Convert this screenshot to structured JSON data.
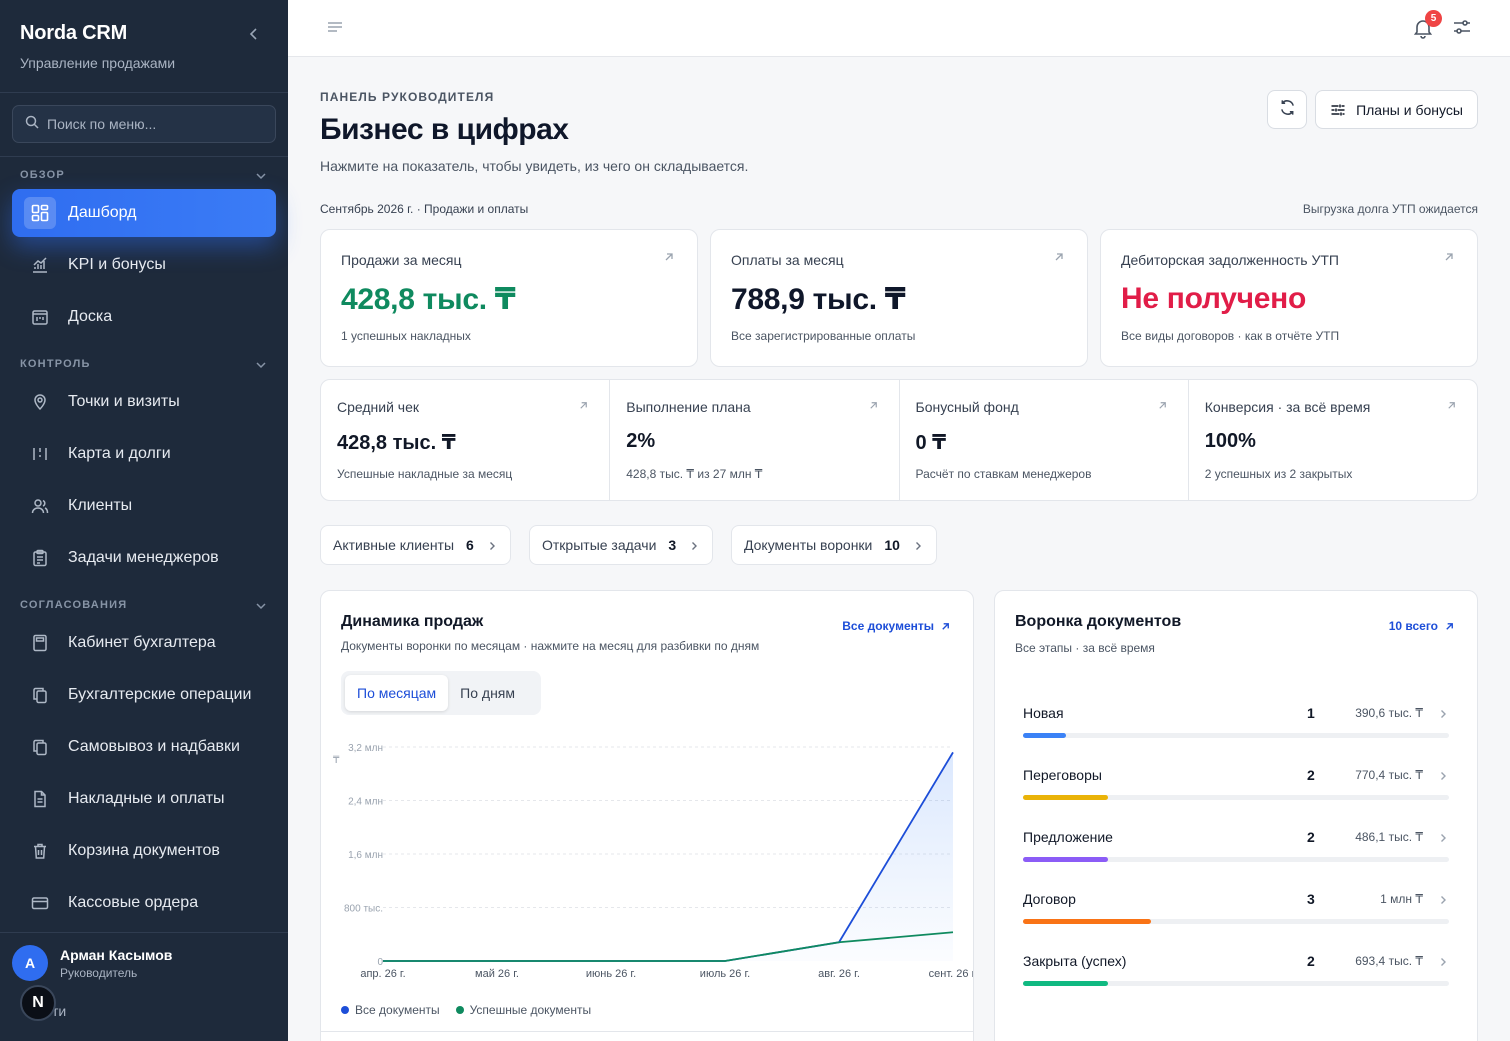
{
  "sidebar": {
    "brand_title": "Norda CRM",
    "brand_subtitle": "Управление продажами",
    "search_placeholder": "Поиск по меню...",
    "sections": {
      "overview": "ОБЗОР",
      "control": "КОНТРОЛЬ",
      "approvals": "СОГЛАСОВАНИЯ"
    },
    "items": [
      {
        "label": "Дашборд",
        "icon": "dashboard-icon",
        "active": true
      },
      {
        "label": "KPI и бонусы",
        "icon": "chart-icon"
      },
      {
        "label": "Доска",
        "icon": "board-icon"
      },
      {
        "label": "Точки и визиты",
        "icon": "map-pin-icon"
      },
      {
        "label": "Карта и долги",
        "icon": "map-icon"
      },
      {
        "label": "Клиенты",
        "icon": "users-icon"
      },
      {
        "label": "Задачи менеджеров",
        "icon": "clipboard-icon"
      },
      {
        "label": "Кабинет бухгалтера",
        "icon": "calculator-icon"
      },
      {
        "label": "Бухгалтерские операции",
        "icon": "copy-icon"
      },
      {
        "label": "Самовывоз и надбавки",
        "icon": "copy-icon"
      },
      {
        "label": "Накладные и оплаты",
        "icon": "file-icon"
      },
      {
        "label": "Корзина документов",
        "icon": "trash-icon"
      },
      {
        "label": "Кассовые ордера",
        "icon": "card-icon"
      }
    ],
    "user": {
      "initial": "А",
      "name": "Арман Касымов",
      "role": "Руководитель"
    },
    "logout_partial": "ти",
    "n_badge": "N"
  },
  "topbar": {
    "notifications_count": "5"
  },
  "header": {
    "eyebrow": "ПАНЕЛЬ РУКОВОДИТЕЛЯ",
    "title": "Бизнес в цифрах",
    "subtitle": "Нажмите на показатель, чтобы увидеть, из чего он складывается.",
    "plans_button": "Планы и бонусы",
    "meta_left": "Сентябрь 2026 г. · Продажи и оплаты",
    "meta_right": "Выгрузка долга УТП ожидается"
  },
  "kpis": [
    {
      "label": "Продажи за месяц",
      "value": "428,8 тыс. ₸",
      "note": "1 успешных накладных",
      "color": "#0f8a5f"
    },
    {
      "label": "Оплаты за месяц",
      "value": "788,9 тыс. ₸",
      "note": "Все зарегистрированные оплаты",
      "color": "#0f172a"
    },
    {
      "label": "Дебиторская задолженность УТП",
      "value": "Не получено",
      "note": "Все виды договоров · как в отчёте УТП",
      "color": "#e11d48"
    }
  ],
  "stats": [
    {
      "label": "Средний чек",
      "value": "428,8 тыс. ₸",
      "note": "Успешные накладные за месяц"
    },
    {
      "label": "Выполнение плана",
      "value": "2%",
      "note": "428,8 тыс. ₸ из 27 млн ₸"
    },
    {
      "label": "Бонусный фонд",
      "value": "0 ₸",
      "note": "Расчёт по ставкам менеджеров"
    },
    {
      "label": "Конверсия · за всё время",
      "value": "100%",
      "note": "2 успешных из 2 закрытых"
    }
  ],
  "chips": [
    {
      "label": "Активные клиенты",
      "count": "6"
    },
    {
      "label": "Открытые задачи",
      "count": "3"
    },
    {
      "label": "Документы воронки",
      "count": "10"
    }
  ],
  "sales_chart": {
    "title": "Динамика продаж",
    "subtitle": "Документы воронки по месяцам · нажмите на месяц для разбивки по дням",
    "link": "Все документы",
    "tabs": [
      "По месяцам",
      "По дням"
    ],
    "legend": [
      "Все документы",
      "Успешные документы"
    ]
  },
  "chart_data": {
    "type": "area",
    "categories": [
      "апр. 26 г.",
      "май 26 г.",
      "июнь 26 г.",
      "июль 26 г.",
      "авг. 26 г.",
      "сент. 26 г."
    ],
    "y_ticks": [
      "0",
      "800 тыс.",
      "1,6 млн",
      "2,4 млн",
      "3,2 млн"
    ],
    "y_unit": "₸",
    "ylim": [
      0,
      3200000
    ],
    "grid": true,
    "series": [
      {
        "name": "Все документы",
        "color": "#1d4ed8",
        "values": [
          0,
          0,
          0,
          0,
          280000,
          3120000
        ]
      },
      {
        "name": "Успешные документы",
        "color": "#0f8a5f",
        "values": [
          0,
          0,
          0,
          0,
          280000,
          430000
        ]
      }
    ]
  },
  "funnel": {
    "title": "Воронка документов",
    "subtitle": "Все этапы · за всё время",
    "link": "10 всего",
    "stages": [
      {
        "name": "Новая",
        "count": "1",
        "sum": "390,6 тыс. ₸",
        "share": 0.1,
        "color": "#3b82f6"
      },
      {
        "name": "Переговоры",
        "count": "2",
        "sum": "770,4 тыс. ₸",
        "share": 0.2,
        "color": "#eab308"
      },
      {
        "name": "Предложение",
        "count": "2",
        "sum": "486,1 тыс. ₸",
        "share": 0.2,
        "color": "#8b5cf6"
      },
      {
        "name": "Договор",
        "count": "3",
        "sum": "1 млн ₸",
        "share": 0.3,
        "color": "#f97316"
      },
      {
        "name": "Закрыта (успех)",
        "count": "2",
        "sum": "693,4 тыс. ₸",
        "share": 0.2,
        "color": "#10b981"
      }
    ]
  }
}
